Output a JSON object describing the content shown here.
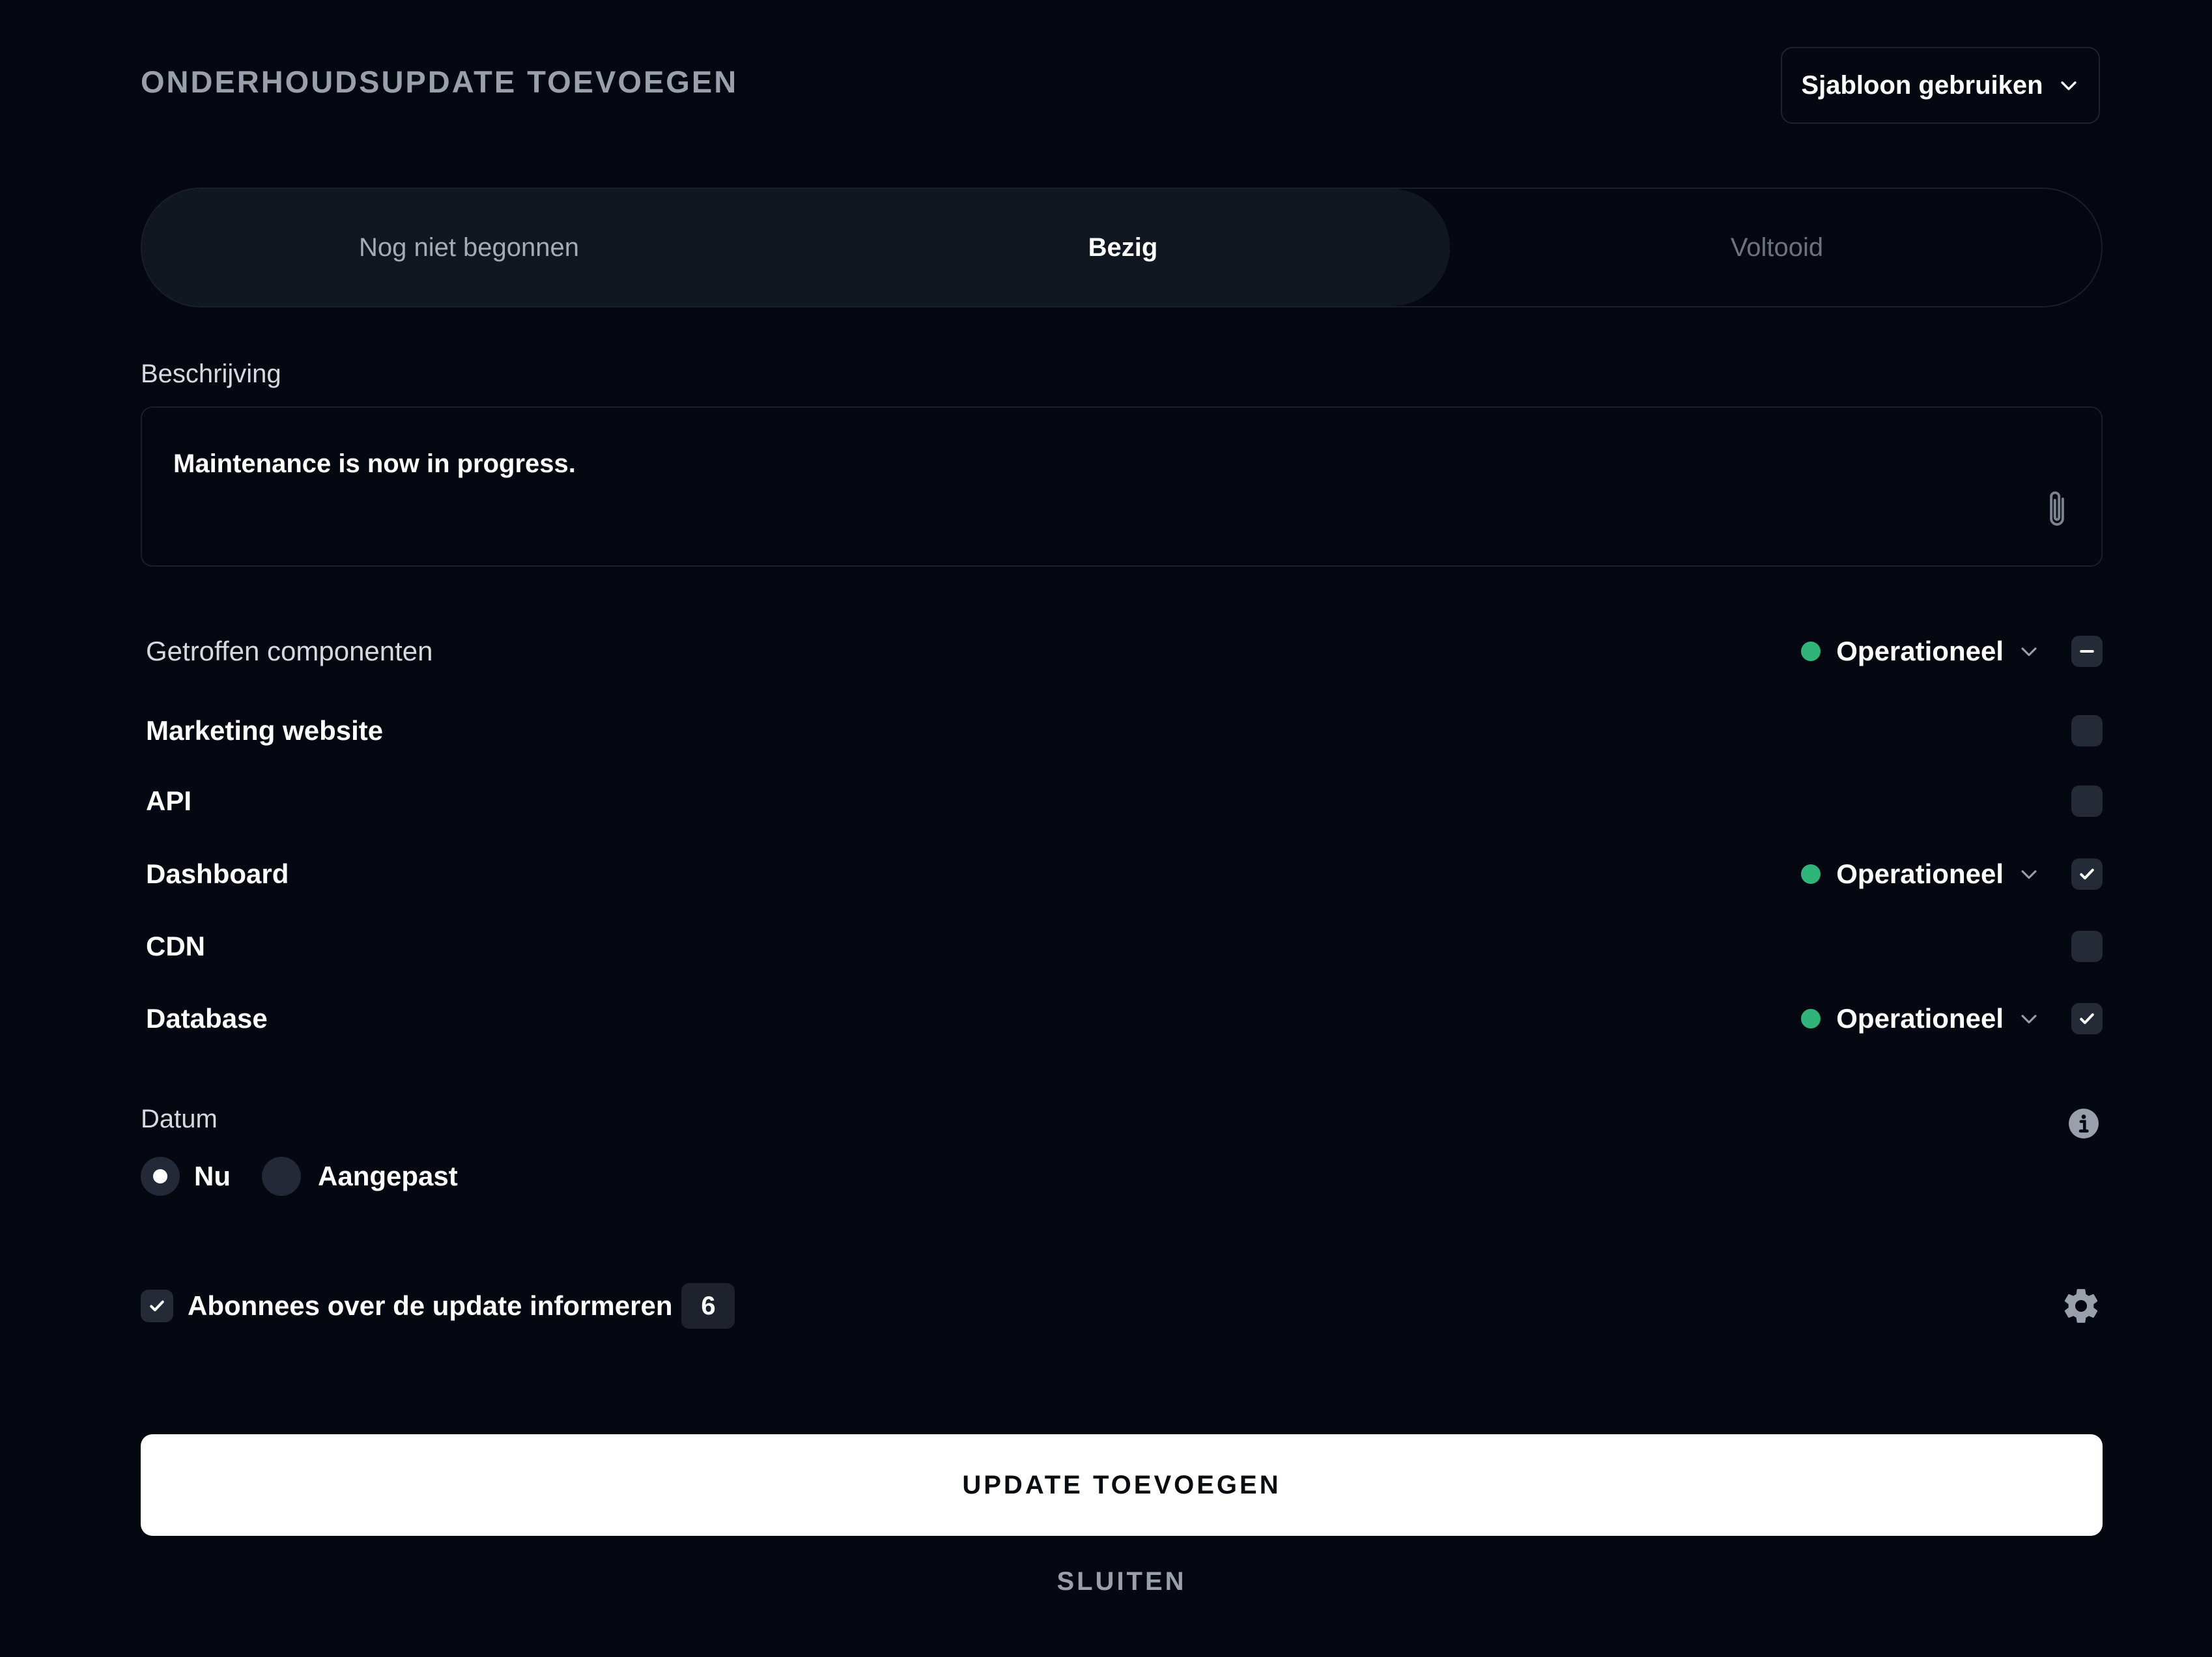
{
  "header": {
    "title": "ONDERHOUDSUPDATE TOEVOEGEN",
    "template_label": "Sjabloon gebruiken"
  },
  "status_tabs": {
    "options": [
      "Nog niet begonnen",
      "Bezig",
      "Voltooid"
    ],
    "selected": "Bezig"
  },
  "description": {
    "label": "Beschrijving",
    "value": "Maintenance is now in progress."
  },
  "components": {
    "header_label": "Getroffen componenten",
    "header_status": "Operationeel",
    "status_color": "#2fb47a",
    "items": [
      {
        "name": "Marketing website",
        "checked": false,
        "status": ""
      },
      {
        "name": "API",
        "checked": false,
        "status": ""
      },
      {
        "name": "Dashboard",
        "checked": true,
        "status": "Operationeel"
      },
      {
        "name": "CDN",
        "checked": false,
        "status": ""
      },
      {
        "name": "Database",
        "checked": true,
        "status": "Operationeel"
      }
    ]
  },
  "date": {
    "label": "Datum",
    "options": [
      "Nu",
      "Aangepast"
    ],
    "selected": "Nu"
  },
  "notify": {
    "label": "Abonnees over de update informeren",
    "checked": true,
    "count": "6"
  },
  "actions": {
    "primary": "UPDATE TOEVOEGEN",
    "close": "SLUITEN"
  }
}
